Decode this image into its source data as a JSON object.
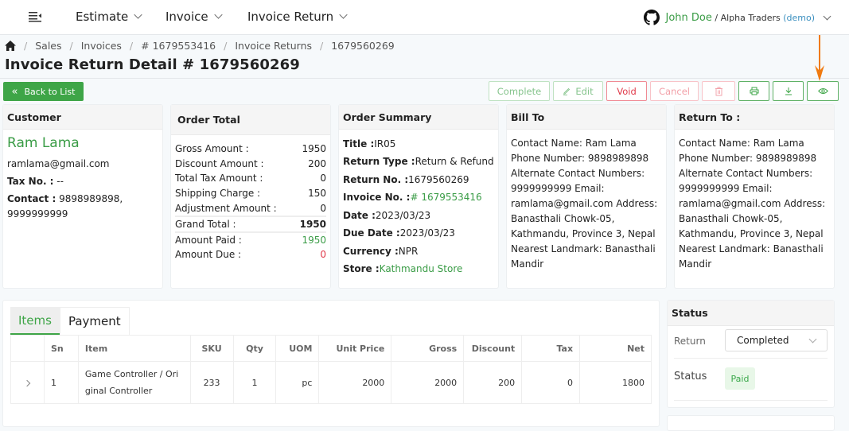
{
  "topbar": {
    "nav": [
      {
        "label": "Estimate"
      },
      {
        "label": "Invoice"
      },
      {
        "label": "Invoice Return"
      }
    ],
    "user": {
      "name": "John Doe",
      "org": " / Alpha Traders ",
      "demo": "(demo)"
    }
  },
  "breadcrumb": [
    {
      "label": "Sales"
    },
    {
      "label": "Invoices"
    },
    {
      "label": "# 1679553416"
    },
    {
      "label": "Invoice Returns"
    },
    {
      "label": "1679560269"
    }
  ],
  "page_title": "Invoice Return Detail # 1679560269",
  "back_button": "Back to List",
  "actions": {
    "complete": "Complete",
    "edit": "Edit",
    "void": "Void",
    "cancel": "Cancel"
  },
  "customer": {
    "title": "Customer",
    "name": "Ram Lama",
    "email": "ramlama@gmail.com",
    "tax_label": "Tax No. :",
    "tax_value": " --",
    "contact_label": "Contact :",
    "contact_value": " 9898989898, 9999999999"
  },
  "order_total": {
    "title": "Order Total",
    "rows": [
      {
        "label": "Gross Amount :",
        "value": "1950"
      },
      {
        "label": "Discount Amount :",
        "value": "200"
      },
      {
        "label": "Total Tax Amount :",
        "value": "0"
      },
      {
        "label": "Shipping Charge :",
        "value": "150"
      },
      {
        "label": "Adjustment Amount :",
        "value": "0"
      }
    ],
    "grand_total_label": "Grand Total :",
    "grand_total": "1950",
    "paid_label": "Amount Paid :",
    "paid": "1950",
    "due_label": "Amount Due :",
    "due": "0"
  },
  "order_summary": {
    "title": "Order Summary",
    "rows": [
      {
        "label": "Title :",
        "value": "IR05"
      },
      {
        "label": "Return Type :",
        "value": "Return & Refund"
      },
      {
        "label": "Return No. :",
        "value": " 1679560269"
      },
      {
        "label": "Invoice No. :",
        "value": " # 1679553416"
      },
      {
        "label": "Date :",
        "value": " 2023/03/23"
      },
      {
        "label": "Due Date :",
        "value": " 2023/03/23"
      },
      {
        "label": "Currency :",
        "value": " NPR"
      },
      {
        "label": "Store :",
        "value": " Kathmandu Store"
      }
    ]
  },
  "bill_to": {
    "title": "Bill To",
    "text": "Contact Name: Ram Lama Phone Number: 9898989898 Alternate Contact Numbers: 9999999999 Email: ramlama@gmail.com Address: Banasthali Chowk-05, Kathmandu, Province 3, Nepal Nearest Landmark: Banasthali Mandir"
  },
  "return_to": {
    "title": "Return To :",
    "text": "Contact Name: Ram Lama Phone Number: 9898989898 Alternate Contact Numbers: 9999999999 Email: ramlama@gmail.com Address: Banasthali Chowk-05, Kathmandu, Province 3, Nepal Nearest Landmark: Banasthali Mandir"
  },
  "tabs": [
    {
      "label": "Items"
    },
    {
      "label": "Payment"
    }
  ],
  "items_table": {
    "headers": [
      "",
      "Sn",
      "Item",
      "SKU",
      "Qty",
      "UOM",
      "Unit Price",
      "Gross",
      "Discount",
      "Tax",
      "Net"
    ],
    "rows": [
      {
        "sn": "1",
        "item": "Game Controller / Original Controller",
        "sku": "233",
        "qty": "1",
        "uom": "pc",
        "unit_price": "2000",
        "gross": "2000",
        "discount": "200",
        "tax": "0",
        "net": "1800"
      }
    ]
  },
  "status_panel": {
    "title": "Status",
    "return_label": "Return",
    "return_value": "Completed",
    "status_label": "Status",
    "status_value": "Paid"
  },
  "colors": {
    "primary": "#3ea547",
    "danger": "#e03a4a",
    "annotation_arrow": "#f07a10"
  }
}
